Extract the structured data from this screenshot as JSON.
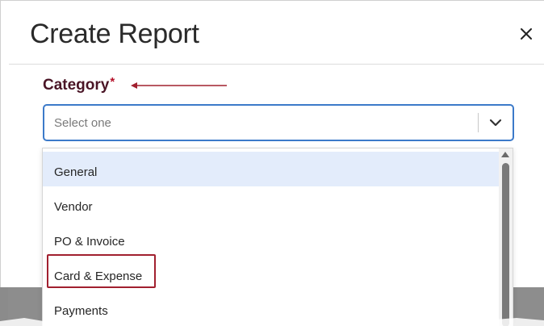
{
  "dialog": {
    "title": "Create Report",
    "close_label": "×"
  },
  "category": {
    "label": "Category",
    "required_marker": "*",
    "placeholder": "Select one"
  },
  "options": [
    {
      "label": "General"
    },
    {
      "label": "Vendor"
    },
    {
      "label": "PO & Invoice"
    },
    {
      "label": "Card & Expense"
    },
    {
      "label": "Payments"
    }
  ],
  "colors": {
    "label_text": "#4a1526",
    "required": "#b5122a",
    "focus_border": "#3c7ac9",
    "hover_bg": "#e3ecfb",
    "annotation": "#a1202f"
  }
}
